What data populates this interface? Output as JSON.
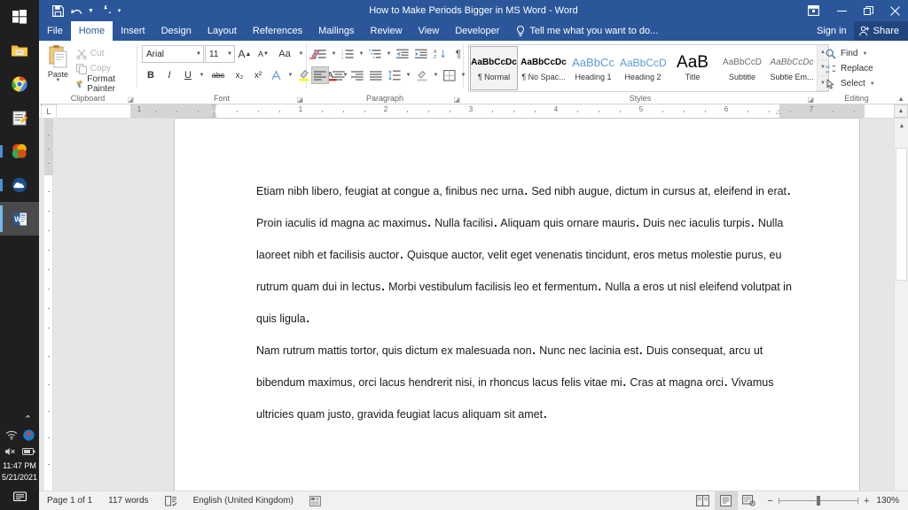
{
  "taskbar": {
    "items": [
      {
        "name": "start-button",
        "icon": "windows-logo-icon",
        "label": "Start"
      },
      {
        "name": "file-explorer",
        "icon": "folder-icon",
        "label": "File Explorer"
      },
      {
        "name": "chrome",
        "icon": "chrome-icon",
        "label": "Google Chrome"
      },
      {
        "name": "notepad",
        "icon": "notepad-icon",
        "label": "Notepad"
      },
      {
        "name": "office",
        "icon": "office-icon",
        "label": "Office"
      },
      {
        "name": "onedrive",
        "icon": "onedrive-icon",
        "label": "OneDrive"
      },
      {
        "name": "word",
        "icon": "word-icon",
        "label": "Microsoft Word"
      }
    ],
    "tray": {
      "chevron": "⌃",
      "wifi": "wifi-icon",
      "dropbox": "dropbox-icon",
      "volume": "volume-muted-icon",
      "battery": "battery-icon",
      "time": "11:47 PM",
      "date": "5/21/2021",
      "action_center": "notifications-icon"
    }
  },
  "titlebar": {
    "document_title": "How to Make Periods Bigger in MS Word - Word",
    "qat": [
      {
        "name": "save",
        "label": "Save",
        "icon": "save-icon"
      },
      {
        "name": "undo",
        "label": "Undo",
        "icon": "undo-icon"
      },
      {
        "name": "redo",
        "label": "Redo",
        "icon": "redo-icon"
      },
      {
        "name": "customize-qat",
        "label": "Customize Quick Access Toolbar",
        "icon": "chevron-down-icon"
      }
    ],
    "window_controls": [
      {
        "name": "ribbon-display-options",
        "label": "Ribbon Display Options",
        "glyph": "▢"
      },
      {
        "name": "minimize",
        "label": "Minimize",
        "glyph": "─"
      },
      {
        "name": "restore",
        "label": "Restore Down",
        "glyph": "❐"
      },
      {
        "name": "close",
        "label": "Close",
        "glyph": "✕"
      }
    ]
  },
  "tabs": {
    "file": "File",
    "items": [
      "Home",
      "Insert",
      "Design",
      "Layout",
      "References",
      "Mailings",
      "Review",
      "View",
      "Developer"
    ],
    "active": "Home",
    "tellme_placeholder": "Tell me what you want to do...",
    "signin": "Sign in",
    "share": "Share"
  },
  "ribbon": {
    "clipboard": {
      "label": "Clipboard",
      "paste": "Paste",
      "cut": "Cut",
      "copy": "Copy",
      "format_painter": "Format Painter"
    },
    "font": {
      "label": "Font",
      "font_name": "Arial",
      "font_size": "11",
      "buttons": [
        "Increase Font Size",
        "Decrease Font Size",
        "Change Case",
        "Clear All Formatting",
        "Bold",
        "Italic",
        "Underline",
        "Strikethrough",
        "Subscript",
        "Superscript",
        "Text Effects and Typography",
        "Text Highlight Color",
        "Font Color"
      ],
      "b": "B",
      "i": "I",
      "u": "U",
      "strike": "abc",
      "sub": "x₂",
      "sup": "x²",
      "grow": "A",
      "shrink": "A",
      "case": "Aa"
    },
    "paragraph": {
      "label": "Paragraph",
      "buttons": [
        "Bullets",
        "Numbering",
        "Multilevel List",
        "Decrease Indent",
        "Increase Indent",
        "Sort",
        "Show/Hide Formatting Marks",
        "Align Left",
        "Center",
        "Align Right",
        "Justify",
        "Line and Paragraph Spacing",
        "Shading",
        "Borders"
      ],
      "pilcrow": "¶"
    },
    "styles": {
      "label": "Styles",
      "items": [
        {
          "preview": "AaBbCcDc",
          "name": "¶ Normal",
          "active": true,
          "style": "normal"
        },
        {
          "preview": "AaBbCcDc",
          "name": "¶ No Spac...",
          "active": false,
          "style": "nospace"
        },
        {
          "preview": "AaBbCc",
          "name": "Heading 1",
          "active": false,
          "style": "h1"
        },
        {
          "preview": "AaBbCcD",
          "name": "Heading 2",
          "active": false,
          "style": "h2"
        },
        {
          "preview": "AaB",
          "name": "Title",
          "active": false,
          "style": "title"
        },
        {
          "preview": "AaBbCcD",
          "name": "Subtitle",
          "active": false,
          "style": "subtitle"
        },
        {
          "preview": "AaBbCcDc",
          "name": "Subtle Em...",
          "active": false,
          "style": "emph"
        }
      ]
    },
    "editing": {
      "label": "Editing",
      "find": "Find",
      "replace": "Replace",
      "select": "Select"
    },
    "collapse": "Collapse the Ribbon"
  },
  "ruler": {
    "numbers": [
      "1",
      "1",
      "2",
      "3",
      "4",
      "5",
      "6",
      "7"
    ],
    "horizontal_marks": [
      1,
      2,
      3,
      4,
      5,
      6,
      7
    ],
    "unit": "inches"
  },
  "document": {
    "paragraphs": [
      "Etiam nibh libero, feugiat at congue a, finibus nec urna. Sed nibh augue, dictum in cursus at, eleifend in erat. Proin iaculis id magna ac maximus. Nulla facilisi. Aliquam quis ornare mauris. Duis nec iaculis turpis. Nulla laoreet nibh et facilisis auctor. Quisque auctor, velit eget venenatis tincidunt, eros metus molestie purus, eu rutrum quam dui in lectus. Morbi vestibulum facilisis leo et fermentum. Nulla a eros ut nisl eleifend volutpat in quis ligula.",
      "Nam rutrum mattis tortor, quis dictum ex malesuada non. Nunc nec lacinia est. Duis consequat, arcu ut bibendum maximus, orci lacus hendrerit nisi, in rhoncus lacus felis vitae mi. Cras at magna orci. Vivamus ultricies quam justo, gravida feugiat lacus aliquam sit amet."
    ]
  },
  "statusbar": {
    "page": "Page 1 of 1",
    "words": "117 words",
    "proofing_icon": "proofing-errors-icon",
    "language": "English (United Kingdom)",
    "macro_icon": "record-macro-icon",
    "views": [
      {
        "name": "read-mode",
        "label": "Read Mode",
        "active": false
      },
      {
        "name": "print-layout",
        "label": "Print Layout",
        "active": true
      },
      {
        "name": "web-layout",
        "label": "Web Layout",
        "active": false
      }
    ],
    "zoom_out": "−",
    "zoom_in": "+",
    "zoom": "130%"
  },
  "colors": {
    "word_blue": "#2b579a",
    "share_blue": "#21457f",
    "taskbar": "#1f1f1f",
    "canvas": "#e6e6e6",
    "page": "#ffffff",
    "statusbar": "#f1f1f1"
  }
}
